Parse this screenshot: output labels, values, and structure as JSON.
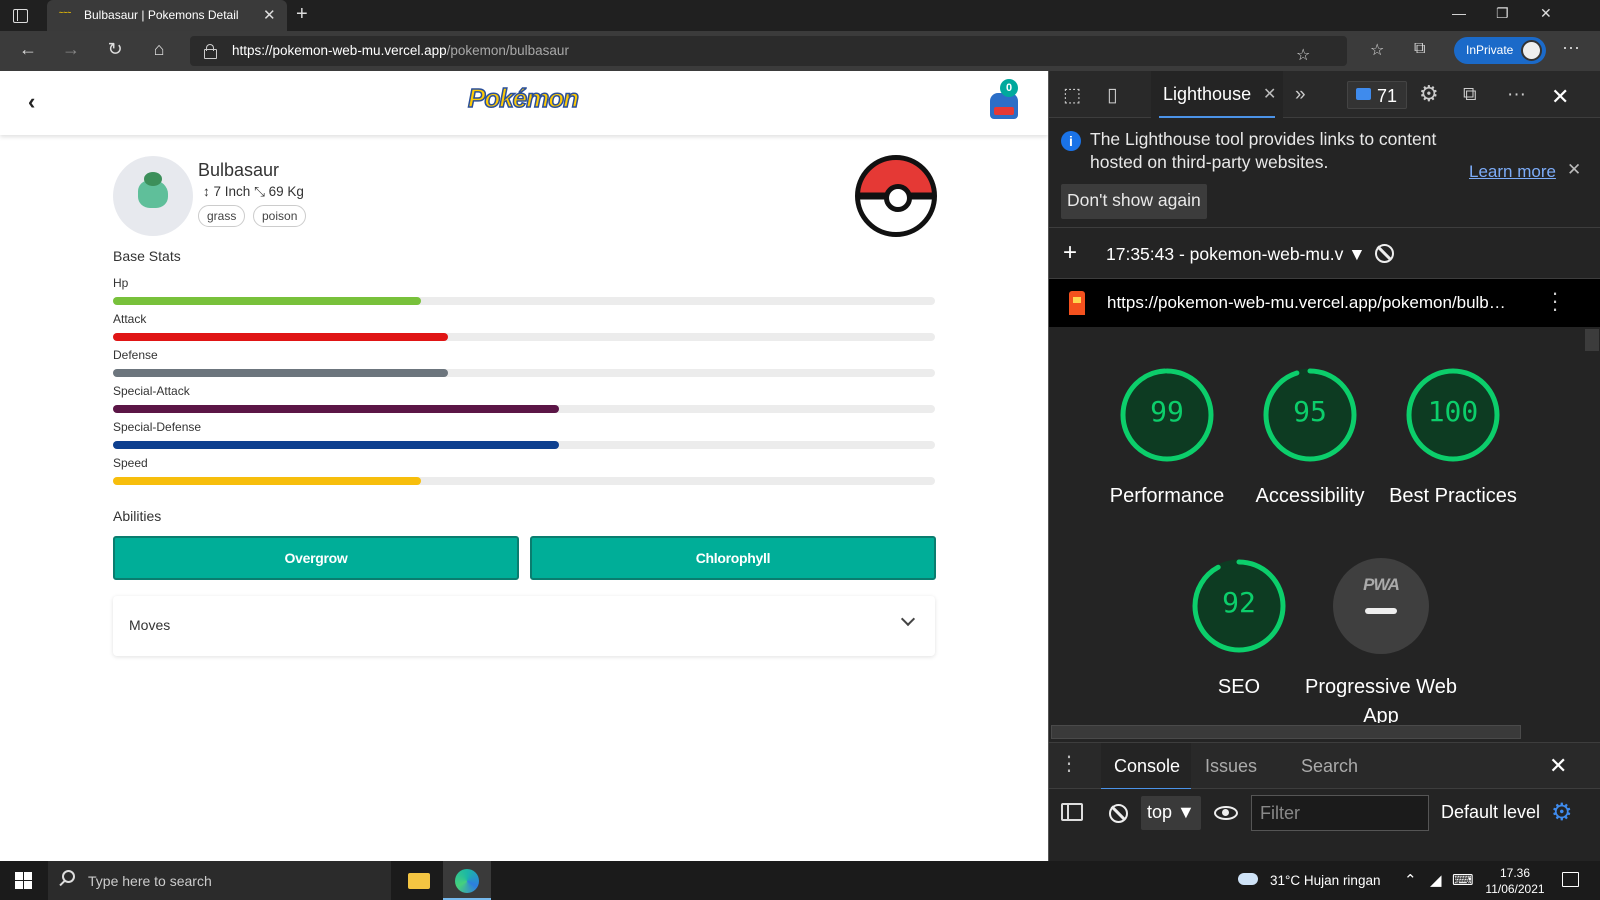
{
  "browser": {
    "tab_title": "Bulbasaur | Pokemons Detail",
    "tab_favicon": "pokemon",
    "url_host": "https://pokemon-web-mu.vercel.app",
    "url_path": "/pokemon/bulbasaur",
    "inprivate_label": "InPrivate"
  },
  "page": {
    "logo_text": "Pokémon",
    "bag_count": "0",
    "pokemon": {
      "name": "Bulbasaur",
      "height": "7 Inch",
      "weight": "69 Kg",
      "types": [
        "grass",
        "poison"
      ]
    },
    "base_stats_title": "Base Stats",
    "stats": [
      {
        "label": "Hp",
        "fraction": 0.375,
        "color": "#78c13b"
      },
      {
        "label": "Attack",
        "fraction": 0.408,
        "color": "#e01515"
      },
      {
        "label": "Defense",
        "fraction": 0.408,
        "color": "#6c757d"
      },
      {
        "label": "Special-Attack",
        "fraction": 0.542,
        "color": "#5b1546"
      },
      {
        "label": "Special-Defense",
        "fraction": 0.542,
        "color": "#0d3f8f"
      },
      {
        "label": "Speed",
        "fraction": 0.375,
        "color": "#f7be0c"
      }
    ],
    "abilities_title": "Abilities",
    "abilities": [
      "Overgrow",
      "Chlorophyll"
    ],
    "moves_label": "Moves"
  },
  "devtools": {
    "active_tab": "Lighthouse",
    "issues_count": "71",
    "info_text": "The Lighthouse tool provides links to content hosted on third-party websites.",
    "learn_more": "Learn more",
    "dont_show_again": "Don't show again",
    "report_select": "17:35:43 - pokemon-web-mu.ᴠ",
    "report_url": "https://pokemon-web-mu.vercel.app/pokemon/bulb…",
    "scores": [
      {
        "value": "99",
        "label": "Performance",
        "score": 99
      },
      {
        "value": "95",
        "label": "Accessibility",
        "score": 95
      },
      {
        "value": "100",
        "label": "Best Practices",
        "score": 100
      },
      {
        "value": "92",
        "label": "SEO",
        "score": 92
      }
    ],
    "pwa_badge": "PWA",
    "pwa_label": "Progressive Web App",
    "score_color": "#0cce6b",
    "drawer_tabs": [
      "Console",
      "Issues",
      "Search"
    ],
    "context": "top",
    "filter_placeholder": "Filter",
    "level": "Default level"
  },
  "taskbar": {
    "search_placeholder": "Type here to search",
    "weather": "31°C  Hujan ringan",
    "time": "17.36",
    "date": "11/06/2021"
  }
}
